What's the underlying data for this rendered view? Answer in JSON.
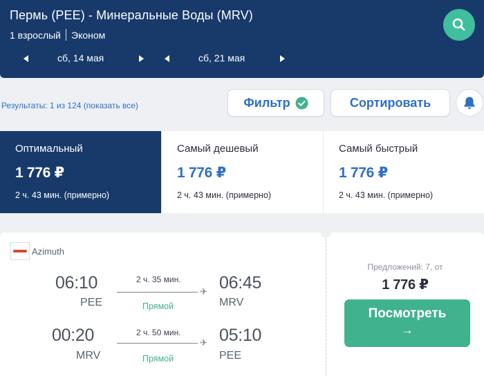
{
  "header": {
    "route": "Пермь (PEE) - Минеральные Воды (MRV)",
    "passengers": "1 взрослый",
    "class": "Эконом",
    "depart_date": "сб, 14 мая",
    "return_date": "сб, 21 мая"
  },
  "toolbar": {
    "results": "Результаты: 1 из 124 (показать все)",
    "filter_label": "Фильтр",
    "sort_label": "Сортировать"
  },
  "sort_tabs": [
    {
      "label": "Оптимальный",
      "price": "1 776 ₽",
      "duration": "2 ч. 43 мин. (примерно)"
    },
    {
      "label": "Самый дешевый",
      "price": "1 776 ₽",
      "duration": "2 ч. 43 мин. (примерно)"
    },
    {
      "label": "Самый быстрый",
      "price": "1 776 ₽",
      "duration": "2 ч. 43 мин. (примерно)"
    }
  ],
  "result": {
    "airline": "Azimuth",
    "outbound": {
      "dep_time": "06:10",
      "dep_code": "PEE",
      "duration": "2 ч. 35 мин.",
      "stops": "Прямой",
      "arr_time": "06:45",
      "arr_code": "MRV"
    },
    "inbound": {
      "dep_time": "00:20",
      "dep_code": "MRV",
      "duration": "2 ч. 50 мин.",
      "stops": "Прямой",
      "arr_time": "05:10",
      "arr_code": "PEE"
    },
    "offers": "Предложений: 7, от",
    "price": "1 776 ₽",
    "view_label": "Посмотреть",
    "view_arrow": "→"
  },
  "colors": {
    "primary": "#173a6b",
    "accent": "#41b28e",
    "link": "#2f6fc4"
  }
}
